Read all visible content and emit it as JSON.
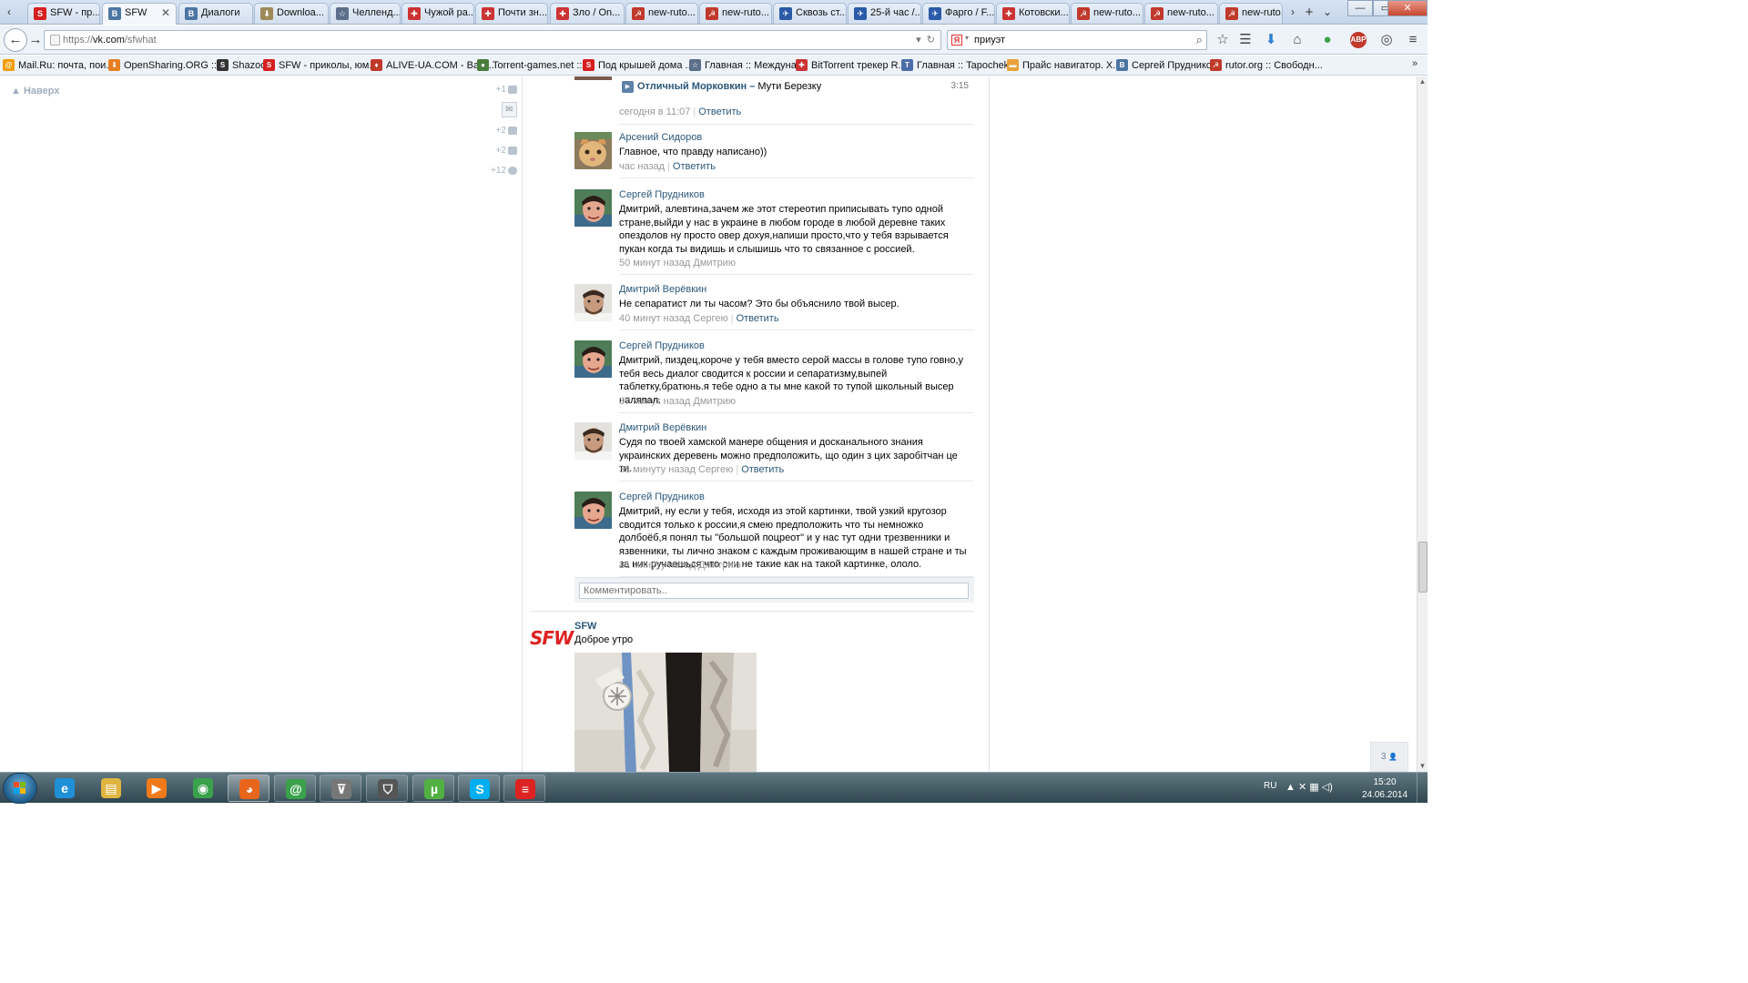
{
  "browser": {
    "tabs": [
      {
        "title": "SFW - пр...",
        "icon": "sfw-icon",
        "color": "#d61f1f",
        "glyph": "S"
      },
      {
        "title": "SFW",
        "icon": "vk-icon",
        "color": "#4c75a3",
        "glyph": "В",
        "active": true,
        "close": "✕"
      },
      {
        "title": "Диалоги",
        "icon": "vk-icon",
        "color": "#4c75a3",
        "glyph": "В"
      },
      {
        "title": "Downloa...",
        "icon": "download-icon",
        "color": "#9c8a58",
        "glyph": "⬇"
      },
      {
        "title": "Челленд...",
        "icon": "star-icon",
        "color": "#5c6f8a",
        "glyph": "☆"
      },
      {
        "title": "Чужой ра...",
        "icon": "puzzle-icon",
        "color": "#c33",
        "glyph": "✚"
      },
      {
        "title": "Почти зн...",
        "icon": "puzzle-icon",
        "color": "#c33",
        "glyph": "✚"
      },
      {
        "title": "Зло / On...",
        "icon": "puzzle-icon",
        "color": "#c33",
        "glyph": "✚"
      },
      {
        "title": "new-ruto...",
        "icon": "rutor-icon",
        "color": "#c0392b",
        "glyph": "☭"
      },
      {
        "title": "new-ruto...",
        "icon": "rutor-icon",
        "color": "#c0392b",
        "glyph": "☭"
      },
      {
        "title": "Сквозь ст...",
        "icon": "fargo-icon",
        "color": "#2a5aa8",
        "glyph": "✈"
      },
      {
        "title": "25-й час /...",
        "icon": "fargo-icon",
        "color": "#2a5aa8",
        "glyph": "✈"
      },
      {
        "title": "Фарго / F...",
        "icon": "fargo-icon",
        "color": "#2a5aa8",
        "glyph": "✈"
      },
      {
        "title": "Котовски...",
        "icon": "puzzle-icon",
        "color": "#c33",
        "glyph": "✚"
      },
      {
        "title": "new-ruto...",
        "icon": "rutor-icon",
        "color": "#c0392b",
        "glyph": "☭"
      },
      {
        "title": "new-ruto...",
        "icon": "rutor-icon",
        "color": "#c0392b",
        "glyph": "☭"
      },
      {
        "title": "new-ruto...",
        "icon": "rutor-icon",
        "color": "#c0392b",
        "glyph": "☭"
      }
    ],
    "tab_scroll_left": "‹",
    "tab_scroll_right": "›",
    "new_tab": "+",
    "tab_list": "⌄",
    "window": {
      "minimize": "—",
      "maximize": "▭",
      "close": "✕"
    },
    "nav": {
      "back": "←",
      "forward": "→",
      "url_prefix": "https://",
      "url_host": "vk.com",
      "url_path": "/sfwhat",
      "url_dropdown": "▾",
      "reload": "↻",
      "search_engine_glyph": "Я",
      "search_text": "приуэт",
      "search_button": "⌕"
    },
    "toolbar_glyphs": {
      "star": "☆",
      "reader": "☰",
      "download": "⬇",
      "home": "⌂",
      "addon": "●",
      "abp": "ABP",
      "sync": "◎",
      "menu": "≡"
    },
    "bookmarks": [
      {
        "label": "Mail.Ru: почта, пои...",
        "icon": "mailru-icon",
        "color": "#f29b00",
        "glyph": "@"
      },
      {
        "label": "OpenSharing.ORG ::...",
        "icon": "opensharing-icon",
        "color": "#e67e22",
        "glyph": "⬇"
      },
      {
        "label": "Shazoo",
        "icon": "shazoo-icon",
        "color": "#333",
        "glyph": "S"
      },
      {
        "label": "SFW - приколы, юм...",
        "icon": "sfw-icon",
        "color": "#d61f1f",
        "glyph": "S"
      },
      {
        "label": "ALIVE-UA.COM - Вам...",
        "icon": "alive-icon",
        "color": "#c0392b",
        "glyph": "♦"
      },
      {
        "label": "Torrent-games.net ::...",
        "icon": "torrent-games-icon",
        "color": "#4a7d3a",
        "glyph": "●"
      },
      {
        "label": "Под крышей дома ...",
        "icon": "sfw-icon",
        "color": "#d61f1f",
        "glyph": "S"
      },
      {
        "label": "Главная :: Междуна...",
        "icon": "star-icon",
        "color": "#5c6f8a",
        "glyph": "☆"
      },
      {
        "label": "BitTorrent трекер R...",
        "icon": "puzzle-icon",
        "color": "#c33",
        "glyph": "✚"
      },
      {
        "label": "Главная :: Tapochek...",
        "icon": "tapochek-icon",
        "color": "#4c6ea8",
        "glyph": "T"
      },
      {
        "label": "Прайс навигатор. Х...",
        "icon": "price-icon",
        "color": "#e8a13b",
        "glyph": "▬"
      },
      {
        "label": "Сергей Прудников",
        "icon": "vk-icon",
        "color": "#4c75a3",
        "glyph": "В"
      },
      {
        "label": "rutor.org :: Свободн...",
        "icon": "rutor-icon",
        "color": "#c0392b",
        "glyph": "☭"
      }
    ]
  },
  "page": {
    "up_link": "Наверх",
    "up_arrow": "▲",
    "side_counters": [
      {
        "value": "+1",
        "icon": "friend-icon"
      },
      {
        "value": "+2",
        "icon": "group-icon"
      },
      {
        "value": "+2",
        "icon": "comment-icon"
      },
      {
        "value": "+12",
        "icon": "settings-icon"
      }
    ],
    "mail_glyph": "✉",
    "audio": {
      "play": "▶",
      "artist": "Отличный Морковкин",
      "dash": " – ",
      "title": "Мути Березку",
      "duration": "3:15"
    },
    "first_meta": {
      "time": "сегодня в 11:07",
      "reply": "Ответить"
    },
    "comments": [
      {
        "author": "Арсений Сидоров",
        "text": "Главное, что правду написано))",
        "time": "час назад",
        "reply": "Ответить",
        "avatar": "cat"
      },
      {
        "author": "Сергей Прудников",
        "text": "Дмитрий, алевтина,зачем же этот стереотип приписывать тупо одной стране,выйди у нас в украине в любом городе в любой деревне таких опездолов ну просто овер дохуя,напиши просто,что у тебя взрывается пукан когда ты видишь и слышишь что то связанное с россией.",
        "time": "50 минут назад Дмитрию",
        "reply": "",
        "avatar": "man1"
      },
      {
        "author": "Дмитрий Верёвкин",
        "text": "Не сепаратист ли ты часом? Это бы объяснило твой высер.",
        "time": "40 минут назад Сергею",
        "reply": "Ответить",
        "avatar": "man2"
      },
      {
        "author": "Сергей Прудников",
        "text": "Дмитрий, пиздец,короче у тебя вместо серой массы в голове тупо говно,у тебя весь диалог сводится к россии и сепаратизму,выпей таблетку,братюнь.я тебе одно а ты мне какой то тупой школьный высер наляпал.",
        "time": "37 минут назад Дмитрию",
        "reply": "",
        "avatar": "man1"
      },
      {
        "author": "Дмитрий Верёвкин",
        "text": "Судя по твоей хамской манере общения и досканального знания украинских деревень можно предположить, що один з цих заробітчан це ти.",
        "time": "31 минуту назад Сергею",
        "reply": "Ответить",
        "avatar": "man2"
      },
      {
        "author": "Сергей Прудников",
        "text": "Дмитрий, ну если у тебя, исходя из этой картинки, твой узкий кругозор сводится только к россии,я смею предположить что ты немножко долбоёб,я понял ты \"большой поцреот\" и у нас тут одни трезвенники и язвенники, ты лично знаком с каждым проживающим в нашей стране и ты за них ручаешься что они не такие как на такой картинке, ололо.",
        "time": "21 минуту назад Дмитрию",
        "reply": "",
        "avatar": "man1"
      }
    ],
    "comment_placeholder": "Комментировать..",
    "post": {
      "logo": "SFW",
      "author": "SFW",
      "text": "Доброе утро"
    },
    "online_count": "3",
    "online_glyph": "👤",
    "accent_color": "#2b587a"
  },
  "taskbar": {
    "language": "RU",
    "tray_glyphs": "▲ ✕ ▦ ◁)",
    "time": "15:20",
    "date": "24.06.2014",
    "apps": [
      {
        "name": "ie-icon",
        "glyph": "e",
        "color": "#1f8fd8"
      },
      {
        "name": "explorer-icon",
        "glyph": "▤",
        "color": "#e0b440"
      },
      {
        "name": "media-player-icon",
        "glyph": "▶",
        "color": "#f07a1a"
      },
      {
        "name": "chrome-icon",
        "glyph": "◉",
        "color": "#3aa24a"
      },
      {
        "name": "firefox-icon",
        "glyph": "◕",
        "color": "#e8661c"
      },
      {
        "name": "mailru-agent-icon",
        "glyph": "@",
        "color": "#3aa24a"
      },
      {
        "name": "wot-launcher-icon",
        "glyph": "⊽",
        "color": "#777"
      },
      {
        "name": "world-of-tanks-icon",
        "glyph": "⛉",
        "color": "#555"
      },
      {
        "name": "utorrent-icon",
        "glyph": "µ",
        "color": "#52b043"
      },
      {
        "name": "skype-icon",
        "glyph": "S",
        "color": "#00aff0"
      },
      {
        "name": "sfw-app-icon",
        "glyph": "≡",
        "color": "#d22"
      }
    ]
  }
}
